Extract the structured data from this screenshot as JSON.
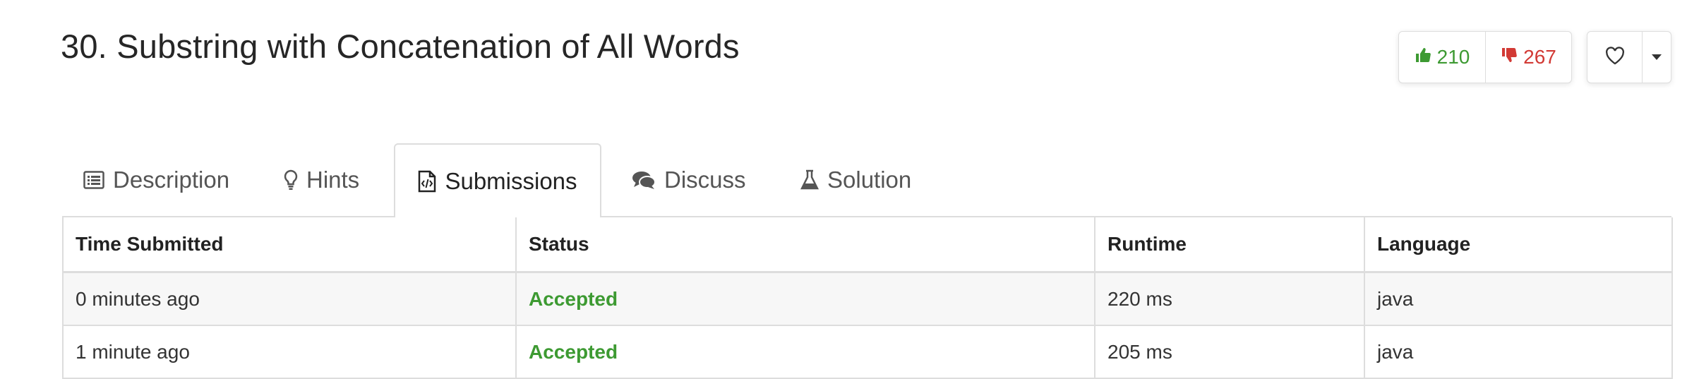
{
  "problem": {
    "title": "30. Substring with Concatenation of All Words"
  },
  "votes": {
    "likes": "210",
    "dislikes": "267"
  },
  "tabs": [
    {
      "label": "Description",
      "icon": "list-icon"
    },
    {
      "label": "Hints",
      "icon": "lightbulb-icon"
    },
    {
      "label": "Submissions",
      "icon": "code-file-icon",
      "active": true
    },
    {
      "label": "Discuss",
      "icon": "comments-icon"
    },
    {
      "label": "Solution",
      "icon": "flask-icon"
    }
  ],
  "table": {
    "headers": [
      "Time Submitted",
      "Status",
      "Runtime",
      "Language"
    ],
    "rows": [
      {
        "time": "0 minutes ago",
        "status": "Accepted",
        "runtime": "220 ms",
        "language": "java"
      },
      {
        "time": "1 minute ago",
        "status": "Accepted",
        "runtime": "205 ms",
        "language": "java"
      }
    ]
  },
  "colors": {
    "accepted": "#3d9a32",
    "like": "#3d9a32",
    "dislike": "#d23a35",
    "border": "#dddddd"
  }
}
